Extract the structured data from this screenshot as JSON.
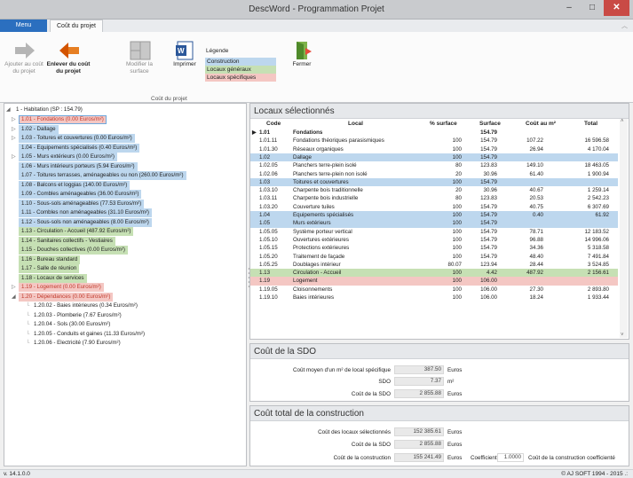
{
  "window": {
    "title": "DescWord - Programmation Projet",
    "min": "–",
    "max": "□",
    "close": "✕"
  },
  "ribbon": {
    "menu_tab": "Menu",
    "active_tab": "Coût du projet",
    "buttons": [
      {
        "label": "Ajouter au coût du projet",
        "enabled": false,
        "icon": "arrow-right-icon"
      },
      {
        "label": "Enlever du coût du projet",
        "enabled": true,
        "icon": "arrow-left-icon"
      },
      {
        "label": "Modifier la surface",
        "enabled": false,
        "icon": "floorplan-icon"
      },
      {
        "label": "Imprimer",
        "enabled": true,
        "icon": "word-icon"
      },
      {
        "label": "Fermer",
        "enabled": true,
        "icon": "exit-door-icon"
      }
    ],
    "group_label": "Coût du projet",
    "legend": {
      "title": "Légende",
      "items": [
        {
          "label": "Construction",
          "color": "#bdd7ee"
        },
        {
          "label": "Locaux généraux",
          "color": "#c6e0b4"
        },
        {
          "label": "Locaux spécifiques",
          "color": "#f4c7c3"
        }
      ]
    }
  },
  "tree": {
    "root": "1 - Habitation (SP : 154.79)",
    "items": [
      {
        "label": "1.01 - Fondations (0.00 Euros/m²)",
        "color": "red",
        "selected": true,
        "expander": "▷"
      },
      {
        "label": "1.02 - Dallage",
        "color": "blue",
        "selected": false,
        "expander": "▷"
      },
      {
        "label": "1.03 - Toitures et couvertures (0.00 Euros/m²)",
        "color": "blue",
        "selected": false,
        "expander": "▷"
      },
      {
        "label": "1.04 - Equipements spécialisés (0.40 Euros/m²)",
        "color": "blue",
        "selected": false,
        "expander": ""
      },
      {
        "label": "1.05 - Murs extérieurs (0.00 Euros/m²)",
        "color": "blue",
        "selected": false,
        "expander": "▷"
      },
      {
        "label": "1.06 - Murs intérieurs porteurs (5.94 Euros/m²)",
        "color": "blue",
        "selected": false,
        "expander": ""
      },
      {
        "label": "1.07 - Toitures terrasses, aménageables ou non (260.00 Euros/m²)",
        "color": "blue",
        "selected": false,
        "expander": ""
      },
      {
        "label": "1.08 - Balcons et loggias (140.00 Euros/m²)",
        "color": "blue",
        "selected": false,
        "expander": ""
      },
      {
        "label": "1.09 - Combles aménageables (36.00 Euros/m²)",
        "color": "blue",
        "selected": false,
        "expander": ""
      },
      {
        "label": "1.10 - Sous-sols aménageables (77.53 Euros/m²)",
        "color": "blue",
        "selected": false,
        "expander": ""
      },
      {
        "label": "1.11 - Combles non aménageables (31.10 Euros/m²)",
        "color": "blue",
        "selected": false,
        "expander": ""
      },
      {
        "label": "1.12 - Sous-sols non aménageables (8.00 Euros/m²)",
        "color": "blue",
        "selected": false,
        "expander": ""
      },
      {
        "label": "1.13 - Circulation - Accueil (487.92 Euros/m²)",
        "color": "green",
        "selected": false,
        "expander": ""
      },
      {
        "label": "1.14 - Sanitaires collectifs - Vestiaires",
        "color": "green",
        "selected": false,
        "expander": ""
      },
      {
        "label": "1.15 - Douches collectives (0.00 Euros/m²)",
        "color": "green",
        "selected": false,
        "expander": ""
      },
      {
        "label": "1.16 - Bureau standard",
        "color": "green",
        "selected": false,
        "expander": ""
      },
      {
        "label": "1.17 - Salle de réunion",
        "color": "green",
        "selected": false,
        "expander": ""
      },
      {
        "label": "1.18 - Locaux de services",
        "color": "green",
        "selected": false,
        "expander": ""
      },
      {
        "label": "1.19 - Logement (0.00 Euros/m²)",
        "color": "red",
        "selected": false,
        "expander": "▷"
      },
      {
        "label": "1.20 - Dépendances (0.00 Euros/m²)",
        "color": "red",
        "selected": false,
        "expander": "◢"
      }
    ],
    "children": [
      "1.20.02 - Baies intérieures (0.34 Euros/m²)",
      "1.20.03 - Plomberie (7.67 Euros/m²)",
      "1.20.04 - Sols (30.00 Euros/m²)",
      "1.20.05 - Conduits et gaines (11.33 Euros/m²)",
      "1.20.06 - Electricité (7.90 Euros/m²)"
    ]
  },
  "locaux": {
    "title": "Locaux sélectionnés",
    "columns": [
      "Code",
      "Local",
      "% surface",
      "Surface",
      "Coût au m²",
      "Total"
    ],
    "rows": [
      {
        "code": "1.01",
        "local": "Fondations",
        "pct": "",
        "surface": "154.79",
        "cout": "",
        "total": "",
        "style": "current"
      },
      {
        "code": "1.01.11",
        "local": "Fondations théoriques parasismiques",
        "pct": "100",
        "surface": "154.79",
        "cout": "107.22",
        "total": "16 596.58",
        "style": ""
      },
      {
        "code": "1.01.30",
        "local": "Réseaux organiques",
        "pct": "100",
        "surface": "154.79",
        "cout": "26.94",
        "total": "4 170.04",
        "style": ""
      },
      {
        "code": "1.02",
        "local": "Dallage",
        "pct": "100",
        "surface": "154.79",
        "cout": "",
        "total": "",
        "style": "blue"
      },
      {
        "code": "1.02.05",
        "local": "Planchers terre-plein isolé",
        "pct": "80",
        "surface": "123.83",
        "cout": "149.10",
        "total": "18 463.05",
        "style": ""
      },
      {
        "code": "1.02.06",
        "local": "Planchers terre-plein non isolé",
        "pct": "20",
        "surface": "30.96",
        "cout": "61.40",
        "total": "1 900.94",
        "style": ""
      },
      {
        "code": "1.03",
        "local": "Toitures et couvertures",
        "pct": "100",
        "surface": "154.79",
        "cout": "",
        "total": "",
        "style": "blue"
      },
      {
        "code": "1.03.10",
        "local": "Charpente bois traditionnelle",
        "pct": "20",
        "surface": "30.96",
        "cout": "40.67",
        "total": "1 259.14",
        "style": ""
      },
      {
        "code": "1.03.11",
        "local": "Charpente bois industrielle",
        "pct": "80",
        "surface": "123.83",
        "cout": "20.53",
        "total": "2 542.23",
        "style": ""
      },
      {
        "code": "1.03.20",
        "local": "Couverture tuiles",
        "pct": "100",
        "surface": "154.79",
        "cout": "40.75",
        "total": "6 307.69",
        "style": ""
      },
      {
        "code": "1.04",
        "local": "Equipements spécialisés",
        "pct": "100",
        "surface": "154.79",
        "cout": "0.40",
        "total": "61.92",
        "style": "blue"
      },
      {
        "code": "1.05",
        "local": "Murs extérieurs",
        "pct": "100",
        "surface": "154.79",
        "cout": "",
        "total": "",
        "style": "blue"
      },
      {
        "code": "1.05.05",
        "local": "Système porteur vertical",
        "pct": "100",
        "surface": "154.79",
        "cout": "78.71",
        "total": "12 183.52",
        "style": ""
      },
      {
        "code": "1.05.10",
        "local": "Ouvertures extérieures",
        "pct": "100",
        "surface": "154.79",
        "cout": "96.88",
        "total": "14 996.06",
        "style": ""
      },
      {
        "code": "1.05.15",
        "local": "Protections extérieures",
        "pct": "100",
        "surface": "154.79",
        "cout": "34.36",
        "total": "5 318.58",
        "style": ""
      },
      {
        "code": "1.05.20",
        "local": "Traitement de façade",
        "pct": "100",
        "surface": "154.79",
        "cout": "48.40",
        "total": "7 491.84",
        "style": ""
      },
      {
        "code": "1.05.25",
        "local": "Doublages intérieur",
        "pct": "80.07",
        "surface": "123.94",
        "cout": "28.44",
        "total": "3 524.85",
        "style": ""
      },
      {
        "code": "1.13",
        "local": "Circulation - Accueil",
        "pct": "100",
        "surface": "4.42",
        "cout": "487.92",
        "total": "2 156.61",
        "style": "green"
      },
      {
        "code": "1.19",
        "local": "Logement",
        "pct": "100",
        "surface": "106.00",
        "cout": "",
        "total": "",
        "style": "red"
      },
      {
        "code": "1.19.05",
        "local": "Cloisonnements",
        "pct": "100",
        "surface": "106.00",
        "cout": "27.30",
        "total": "2 893.80",
        "style": ""
      },
      {
        "code": "1.19.10",
        "local": "Baies intérieures",
        "pct": "100",
        "surface": "106.00",
        "cout": "18.24",
        "total": "1 933.44",
        "style": ""
      }
    ]
  },
  "sdo": {
    "title": "Coût de la SDO",
    "cout_moyen_label": "Coût moyen d'un m² de local spécifique",
    "cout_moyen_value": "387.50",
    "cout_moyen_unit": "Euros",
    "sdo_label": "SDO",
    "sdo_value": "7.37",
    "sdo_unit": "m²",
    "cout_sdo_label": "Coût de la SDO",
    "cout_sdo_value": "2 855.88",
    "cout_sdo_unit": "Euros"
  },
  "total": {
    "title": "Coût total de la construction",
    "locaux_label": "Coût des locaux sélectionnés",
    "locaux_value": "152 385.61",
    "locaux_unit": "Euros",
    "sdo_label": "Coût de la SDO",
    "sdo_value": "2 855.88",
    "sdo_unit": "Euros",
    "construction_label": "Coût de la construction",
    "construction_value": "155 241.49",
    "construction_unit": "Euros",
    "coef_label": "Coefficient",
    "coef_value": "1.0000",
    "coef_result_label": "Coût de la construction coefficienté"
  },
  "status": {
    "version": "v. 14.1.0.0",
    "copyright": "© AJ SOFT 1994 - 2015 .:"
  }
}
